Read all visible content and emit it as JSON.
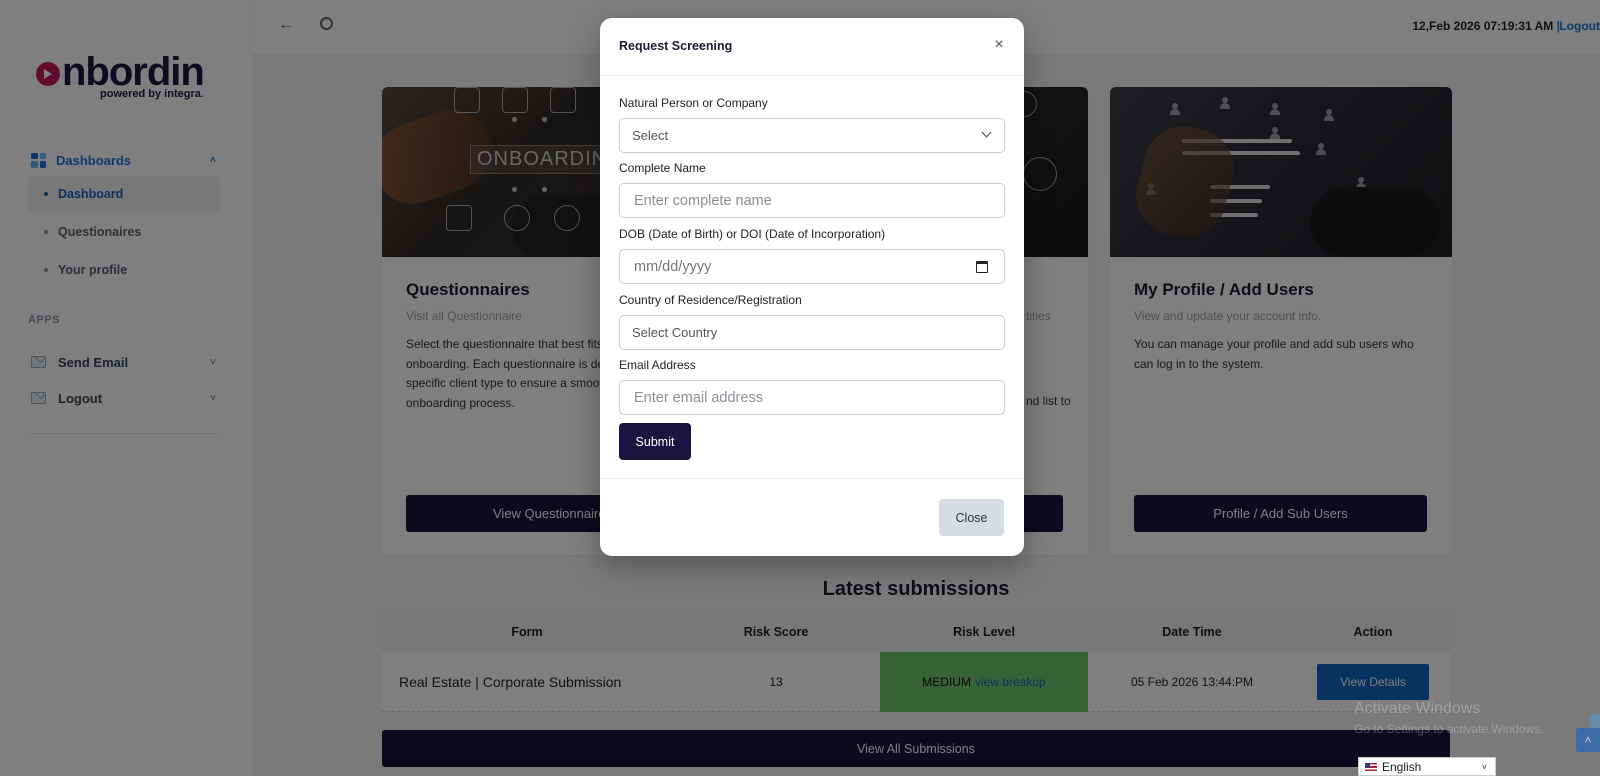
{
  "logo": {
    "text": "nbordin",
    "tagline": "powered by integra",
    "tagline_dot": "."
  },
  "topbar": {
    "datetime": "12,Feb 2026 07:19:31 AM",
    "separator": "|",
    "logout": "Logout"
  },
  "sidebar": {
    "group": "Dashboards",
    "items": [
      {
        "label": "Dashboard",
        "active": true
      },
      {
        "label": "Questionaires",
        "active": false
      },
      {
        "label": "Your profile",
        "active": false
      }
    ],
    "apps_label": "APPS",
    "apps": [
      {
        "label": "Send Email"
      },
      {
        "label": "Logout"
      }
    ]
  },
  "cards": [
    {
      "image_text": "ONBOARDING",
      "title": "Questionnaires",
      "subtitle": "Visit all Questionnaire",
      "description": "Select the questionnaire that best fits and begin onboarding. Each questionnaire is designed for a specific client type to ensure a smooth and accurate onboarding process.",
      "button": "View Questionnaires"
    },
    {
      "title": "",
      "subtitle": "tities",
      "description": "nd list to",
      "button": ""
    },
    {
      "title": "My Profile / Add Users",
      "subtitle": "View and update your account info.",
      "description": "You can manage your profile and add sub users who can log in to the system.",
      "button": "Profile / Add Sub Users"
    }
  ],
  "submissions": {
    "title": "Latest submissions",
    "headers": [
      "Form",
      "Risk Score",
      "Risk Level",
      "Date Time",
      "Action"
    ],
    "rows": [
      {
        "form": "Real Estate | Corporate Submission",
        "risk_score": "13",
        "risk_level": "MEDIUM",
        "risk_link": "view breakup",
        "datetime": "05 Feb 2026 13:44:PM",
        "action": "View Details"
      }
    ],
    "view_all": "View All Submissions"
  },
  "modal": {
    "title": "Request Screening",
    "close_x": "×",
    "fields": {
      "type_label": "Natural Person or Company",
      "type_value": "Select",
      "name_label": "Complete Name",
      "name_placeholder": "Enter complete name",
      "dob_label": "DOB (Date of Birth) or DOI (Date of Incorporation)",
      "dob_placeholder": "mm/dd/yyyy",
      "country_label": "Country of Residence/Registration",
      "country_value": "Select Country",
      "email_label": "Email Address",
      "email_placeholder": "Enter email address"
    },
    "submit": "Submit",
    "close": "Close"
  },
  "watermark": {
    "line1": "Activate Windows",
    "line2": "Go to Settings to activate Windows."
  },
  "language": {
    "selected": "English"
  },
  "colors": {
    "primary_dark": "#1a1540",
    "accent_blue": "#1565c0",
    "medium_risk": "#6dc56d",
    "brand_pink": "#c2185b"
  }
}
